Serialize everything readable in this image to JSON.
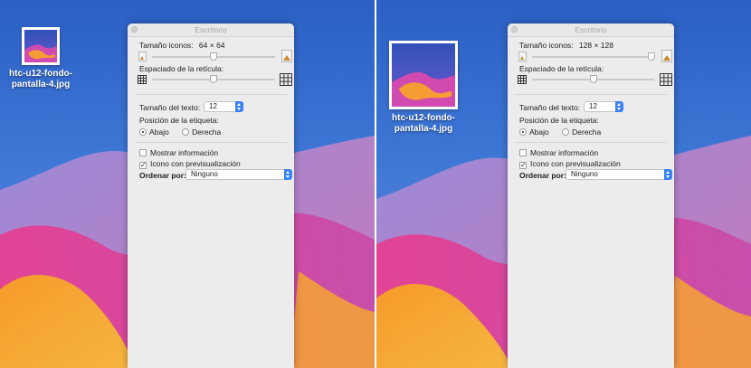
{
  "colors": {
    "panel_bg": "#ececec",
    "accent": "#3b82f6",
    "desktop_top": "#2f63c6"
  },
  "screens": [
    {
      "file": {
        "name_line1": "htc-u12-fondo-",
        "name_line2": "pantalla-4.jpg"
      },
      "panel": {
        "title": "Escritorio",
        "icon_size_label": "Tamaño iconos:",
        "icon_size_value": "64 × 64",
        "icon_size_level": 0.5,
        "grid_spacing_label": "Espaciado de la retícula:",
        "grid_spacing_level": 0.5,
        "text_size_label": "Tamaño del texto:",
        "text_size_value": "12",
        "label_position_label": "Posición de la etiqueta:",
        "option_bottom": "Abajo",
        "option_right": "Derecha",
        "selected_position": "Abajo",
        "show_info_label": "Mostrar información",
        "show_info_checked": false,
        "preview_label": "Icono con previsualización",
        "preview_checked": true,
        "sort_by_label": "Ordenar por:",
        "sort_by_value": "Ninguno"
      }
    },
    {
      "file": {
        "name_line1": "htc-u12-fondo-",
        "name_line2": "pantalla-4.jpg"
      },
      "panel": {
        "title": "Escritorio",
        "icon_size_label": "Tamaño iconos:",
        "icon_size_value": "128 × 128",
        "icon_size_level": 1.0,
        "grid_spacing_label": "Espaciado de la retícula:",
        "grid_spacing_level": 0.5,
        "text_size_label": "Tamaño del texto:",
        "text_size_value": "12",
        "label_position_label": "Posición de la etiqueta:",
        "option_bottom": "Abajo",
        "option_right": "Derecha",
        "selected_position": "Abajo",
        "show_info_label": "Mostrar información",
        "show_info_checked": false,
        "preview_label": "Icono con previsualización",
        "preview_checked": true,
        "sort_by_label": "Ordenar por:",
        "sort_by_value": "Ninguno"
      }
    }
  ]
}
